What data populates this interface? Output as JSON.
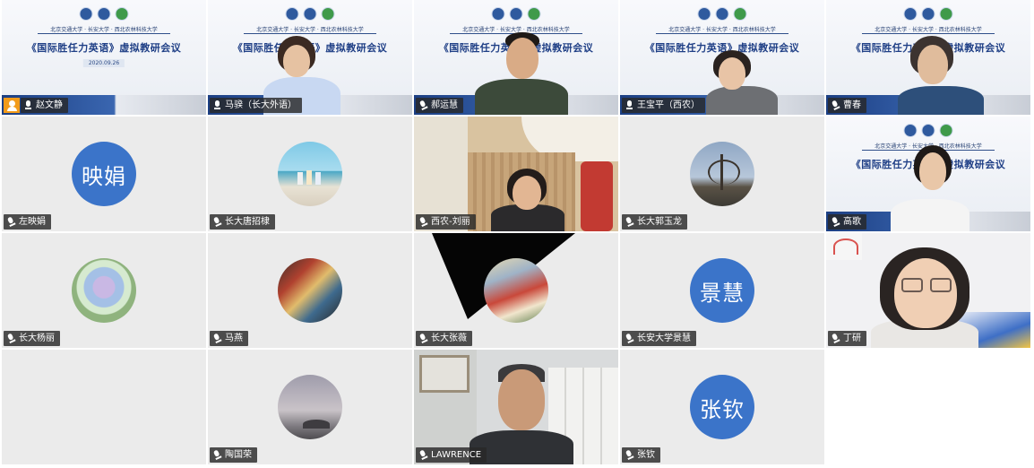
{
  "slide": {
    "universities": "北京交通大学 · 长安大学 · 西北农林科技大学",
    "meeting_title": "《国际胜任力英语》虚拟教研会议",
    "date": "2020.09.26"
  },
  "participants": [
    {
      "name": "赵文静",
      "host": true,
      "mic": "on"
    },
    {
      "name": "马骙（长大外语）",
      "mic": "on",
      "active_speaker": true
    },
    {
      "name": "郝运慧",
      "mic": "muted"
    },
    {
      "name": "王宝平（西农）",
      "mic": "on"
    },
    {
      "name": "曹春",
      "mic": "muted"
    },
    {
      "name": "左映娟",
      "avatar_text": "映娟",
      "mic": "muted"
    },
    {
      "name": "长大唐招棣",
      "mic": "muted"
    },
    {
      "name": "西农-刘丽",
      "mic": "muted"
    },
    {
      "name": "长大郭玉龙",
      "mic": "muted"
    },
    {
      "name": "高歌",
      "mic": "muted"
    },
    {
      "name": "长大杨丽",
      "mic": "muted"
    },
    {
      "name": "马燕",
      "mic": "muted"
    },
    {
      "name": "长大张薇",
      "mic": "muted"
    },
    {
      "name": "长安大学景慧",
      "avatar_text": "景慧",
      "mic": "muted"
    },
    {
      "name": "丁研",
      "mic": "muted"
    },
    {
      "name": "陶国荣",
      "mic": "muted"
    },
    {
      "name": "LAWRENCE",
      "mic": "muted"
    },
    {
      "name": "张钦",
      "avatar_text": "张钦",
      "mic": "muted"
    }
  ],
  "colors": {
    "tile_bg": "#ebebeb",
    "avatar_blue": "#3b74c9",
    "active_outline": "#5fd38a",
    "host_badge": "#f29b1a",
    "slide_navy": "#1f3f86"
  }
}
